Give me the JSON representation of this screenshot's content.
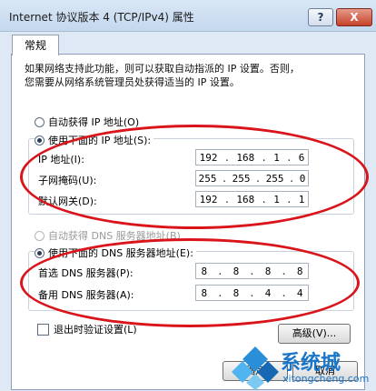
{
  "window": {
    "title": "Internet 协议版本 4 (TCP/IPv4) 属性",
    "help_label": "?",
    "close_label": "X"
  },
  "tabs": [
    {
      "label": "常规"
    }
  ],
  "description": {
    "line1": "如果网络支持此功能，则可以获取自动指派的 IP 设置。否则，",
    "line2": "您需要从网络系统管理员处获得适当的 IP 设置。"
  },
  "ip_section": {
    "auto_label": "自动获得 IP 地址(O)",
    "manual_label": "使用下面的 IP 地址(S):",
    "fields": [
      {
        "label": "IP 地址(I):",
        "value": [
          "192",
          "168",
          "1",
          "6"
        ]
      },
      {
        "label": "子网掩码(U):",
        "value": [
          "255",
          "255",
          "255",
          "0"
        ]
      },
      {
        "label": "默认网关(D):",
        "value": [
          "192",
          "168",
          "1",
          "1"
        ]
      }
    ]
  },
  "dns_section": {
    "auto_label": "自动获得 DNS 服务器地址(B)",
    "manual_label": "使用下面的 DNS 服务器地址(E):",
    "fields": [
      {
        "label": "首选 DNS 服务器(P):",
        "value": [
          "8",
          "8",
          "8",
          "8"
        ]
      },
      {
        "label": "备用 DNS 服务器(A):",
        "value": [
          "8",
          "8",
          "4",
          "4"
        ]
      }
    ]
  },
  "options": {
    "validate_label": "退出时验证设置(L)",
    "advanced_label": "高级(V)..."
  },
  "buttons": {
    "ok_label": "确定",
    "cancel_label": "取消"
  },
  "watermark": {
    "name": "系统城",
    "url": "xitongcheng.com"
  },
  "colors": {
    "highlight_oval": "#d9151b",
    "window_frame": "#dfe9f5"
  }
}
